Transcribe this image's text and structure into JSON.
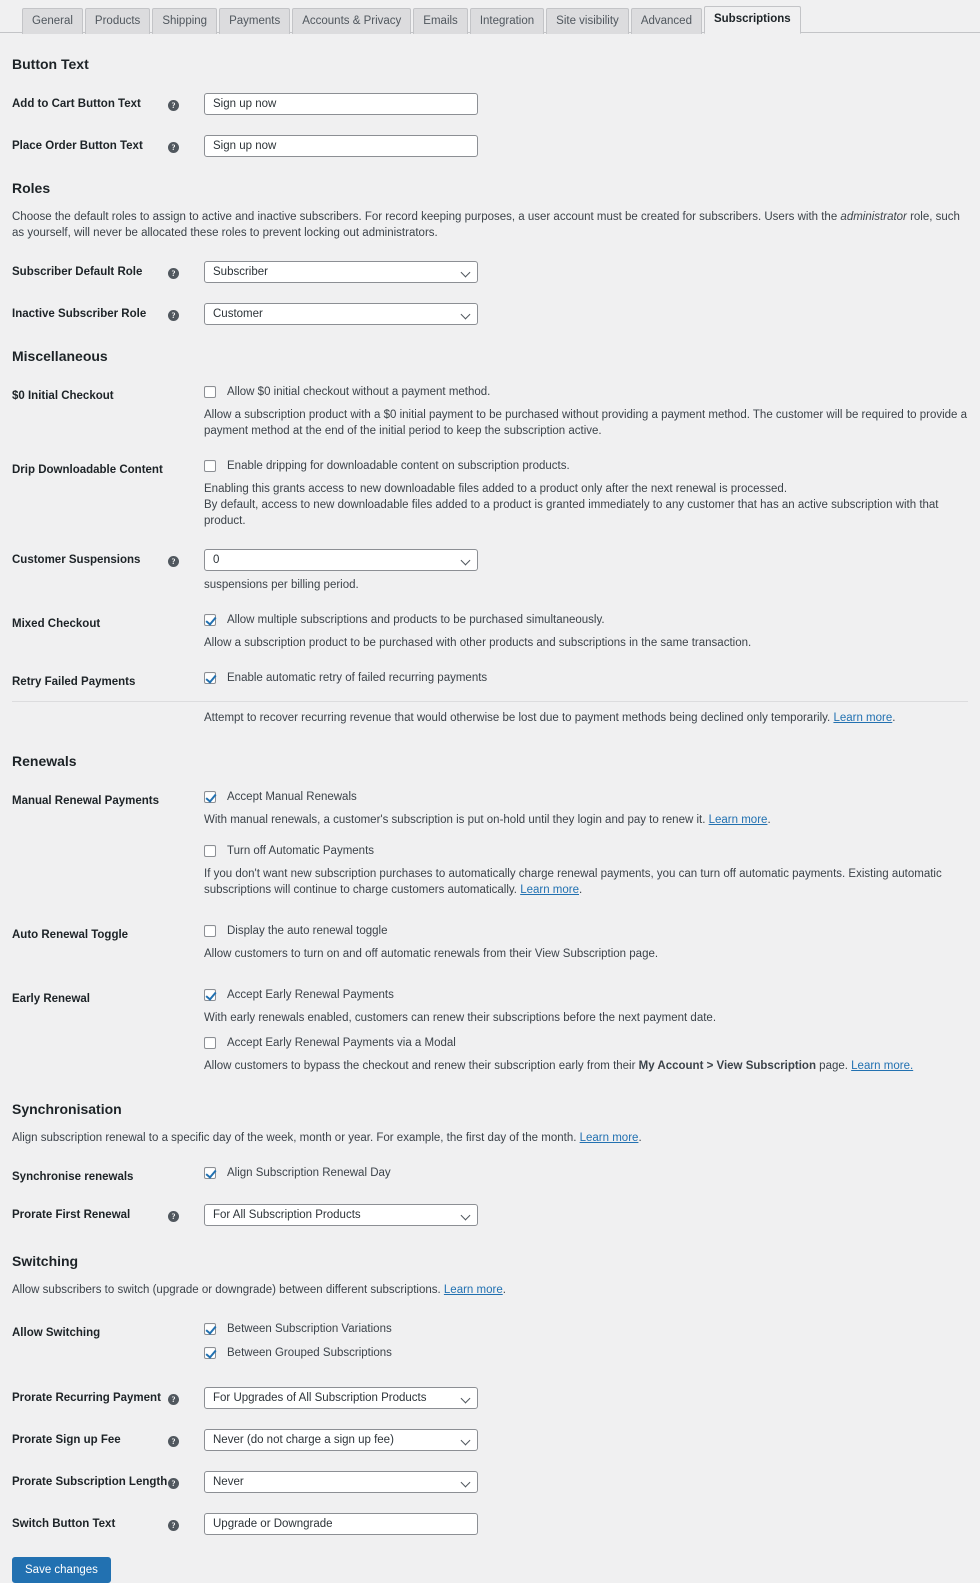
{
  "tabs": [
    {
      "label": "General",
      "active": false
    },
    {
      "label": "Products",
      "active": false
    },
    {
      "label": "Shipping",
      "active": false
    },
    {
      "label": "Payments",
      "active": false
    },
    {
      "label": "Accounts & Privacy",
      "active": false
    },
    {
      "label": "Emails",
      "active": false
    },
    {
      "label": "Integration",
      "active": false
    },
    {
      "label": "Site visibility",
      "active": false
    },
    {
      "label": "Advanced",
      "active": false
    },
    {
      "label": "Subscriptions",
      "active": true
    }
  ],
  "help_icon_glyph": "?",
  "colors": {
    "accent": "#2271b1",
    "page_bg": "#f0f0f1",
    "border": "#c3c4c7",
    "text": "#3c434a"
  },
  "sections": {
    "button_text": {
      "title": "Button Text",
      "add_to_cart": {
        "label": "Add to Cart Button Text",
        "value": "Sign up now"
      },
      "place_order": {
        "label": "Place Order Button Text",
        "value": "Sign up now"
      }
    },
    "roles": {
      "title": "Roles",
      "description_1": "Choose the default roles to assign to active and inactive subscribers. For record keeping purposes, a user account must be created for subscribers. Users with the ",
      "description_em": "administrator",
      "description_2": " role, such as yourself, will never be allocated these roles to prevent locking out administrators.",
      "subscriber_default": {
        "label": "Subscriber Default Role",
        "value": "Subscriber"
      },
      "inactive_subscriber": {
        "label": "Inactive Subscriber Role",
        "value": "Customer"
      }
    },
    "miscellaneous": {
      "title": "Miscellaneous",
      "zero_initial_checkout": {
        "label": "$0 Initial Checkout",
        "checkbox_label": "Allow $0 initial checkout without a payment method.",
        "checked": false,
        "description": "Allow a subscription product with a $0 initial payment to be purchased without providing a payment method. The customer will be required to provide a payment method at the end of the initial period to keep the subscription active."
      },
      "drip_downloadable": {
        "label": "Drip Downloadable Content",
        "checkbox_label": "Enable dripping for downloadable content on subscription products.",
        "checked": false,
        "description_line1": "Enabling this grants access to new downloadable files added to a product only after the next renewal is processed.",
        "description_line2": "By default, access to new downloadable files added to a product is granted immediately to any customer that has an active subscription with that product."
      },
      "customer_suspensions": {
        "label": "Customer Suspensions",
        "value": "0",
        "suffix_note": "suspensions per billing period."
      },
      "mixed_checkout": {
        "label": "Mixed Checkout",
        "checkbox_label": "Allow multiple subscriptions and products to be purchased simultaneously.",
        "checked": true,
        "description": "Allow a subscription product to be purchased with other products and subscriptions in the same transaction."
      },
      "retry_failed_payments": {
        "label": "Retry Failed Payments",
        "checkbox_label": "Enable automatic retry of failed recurring payments",
        "checked": true,
        "description_pre": "Attempt to recover recurring revenue that would otherwise be lost due to payment methods being declined only temporarily. ",
        "learn_more": "Learn more",
        "description_post": "."
      }
    },
    "renewals": {
      "title": "Renewals",
      "manual_renewal_payments": {
        "label": "Manual Renewal Payments",
        "checkbox_label": "Accept Manual Renewals",
        "checked": true,
        "description_pre": "With manual renewals, a customer's subscription is put on-hold until they login and pay to renew it. ",
        "learn_more": "Learn more",
        "description_post": ".",
        "checkbox2_label": "Turn off Automatic Payments",
        "checked2": false,
        "description2_pre": "If you don't want new subscription purchases to automatically charge renewal payments, you can turn off automatic payments. Existing automatic subscriptions will continue to charge customers automatically. ",
        "learn_more2": "Learn more",
        "description2_post": "."
      },
      "auto_renewal_toggle": {
        "label": "Auto Renewal Toggle",
        "checkbox_label": "Display the auto renewal toggle",
        "checked": false,
        "description": "Allow customers to turn on and off automatic renewals from their View Subscription page."
      },
      "early_renewal": {
        "label": "Early Renewal",
        "checkbox_label": "Accept Early Renewal Payments",
        "checked": true,
        "description": "With early renewals enabled, customers can renew their subscriptions before the next payment date.",
        "checkbox2_label": "Accept Early Renewal Payments via a Modal",
        "checked2": false,
        "description2_pre": "Allow customers to bypass the checkout and renew their subscription early from their ",
        "description2_bold": "My Account > View Subscription",
        "description2_mid": " page. ",
        "learn_more2": "Learn more.",
        "description2_post": ""
      }
    },
    "synchronisation": {
      "title": "Synchronisation",
      "description_pre": "Align subscription renewal to a specific day of the week, month or year. For example, the first day of the month. ",
      "learn_more": "Learn more",
      "description_post": ".",
      "synchronise_renewals": {
        "label": "Synchronise renewals",
        "checkbox_label": "Align Subscription Renewal Day",
        "checked": true
      },
      "prorate_first_renewal": {
        "label": "Prorate First Renewal",
        "value": "For All Subscription Products"
      }
    },
    "switching": {
      "title": "Switching",
      "description_pre": "Allow subscribers to switch (upgrade or downgrade) between different subscriptions. ",
      "learn_more": "Learn more",
      "description_post": ".",
      "allow_switching": {
        "label": "Allow Switching",
        "checkbox1_label": "Between Subscription Variations",
        "checked1": true,
        "checkbox2_label": "Between Grouped Subscriptions",
        "checked2": true
      },
      "prorate_recurring_payment": {
        "label": "Prorate Recurring Payment",
        "value": "For Upgrades of All Subscription Products"
      },
      "prorate_sign_up_fee": {
        "label": "Prorate Sign up Fee",
        "value": "Never (do not charge a sign up fee)"
      },
      "prorate_subscription_length": {
        "label": "Prorate Subscription Length",
        "value": "Never"
      },
      "switch_button_text": {
        "label": "Switch Button Text",
        "value": "Upgrade or Downgrade"
      }
    }
  },
  "footer": {
    "save_label": "Save changes"
  }
}
